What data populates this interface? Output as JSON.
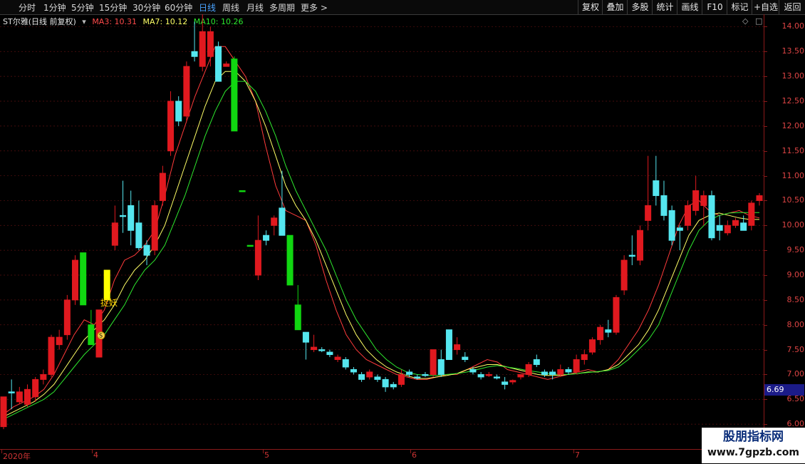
{
  "toolbar": {
    "periods": [
      "分时",
      "1分钟",
      "5分钟",
      "15分钟",
      "30分钟",
      "60分钟",
      "日线",
      "周线",
      "月线",
      "多周期",
      "更多 >"
    ],
    "active_period": "日线",
    "right_buttons": [
      "复权",
      "叠加",
      "多股",
      "统计",
      "画线",
      "F10",
      "标记",
      "+自选",
      "返回"
    ]
  },
  "legend": {
    "title": "ST尔雅(日线 前复权)",
    "ma3": "MA3: 10.31",
    "ma7": "MA7: 10.12",
    "ma10": "MA10: 10.26"
  },
  "annotation": {
    "label": "捉妖",
    "badge": "S"
  },
  "current_price": "6.69",
  "x_labels": [
    "2020年",
    "4",
    "5",
    "6",
    "7"
  ],
  "watermark": {
    "line1": "股朋指标网",
    "line2": "www.7gpzb.com"
  },
  "colors": {
    "up": "#e0191f",
    "down": "#55e6ef",
    "green": "#11d611",
    "yellow": "#ffff00",
    "ma3": "#ff3b3b",
    "ma7": "#ffff66",
    "ma10": "#2ee82e",
    "axis": "#8b1a1a"
  },
  "chart_data": {
    "type": "candlestick",
    "title": "ST尔雅(日线 前复权)",
    "ylim": [
      5.5,
      14.25
    ],
    "y_ticks": [
      6.0,
      6.5,
      7.0,
      7.5,
      8.0,
      8.5,
      9.0,
      9.5,
      10.0,
      10.5,
      11.0,
      11.5,
      12.0,
      12.5,
      13.0,
      13.5,
      14.0
    ],
    "series": [
      {
        "name": "MA3",
        "values": [
          6.2,
          6.35,
          6.45,
          6.55,
          6.7,
          7.0,
          7.4,
          7.8,
          8.1,
          8.0,
          8.3,
          8.9,
          9.3,
          9.4,
          9.6,
          9.9,
          10.6,
          11.4,
          12.0,
          12.6,
          13.1,
          13.6,
          13.6,
          13.3,
          13.0,
          12.5,
          11.6,
          10.8,
          10.3,
          10.2,
          10.1,
          9.6,
          8.9,
          8.3,
          7.8,
          7.5,
          7.3,
          7.2,
          7.1,
          7.0,
          6.95,
          6.9,
          6.9,
          6.95,
          7.0,
          7.0,
          7.1,
          7.2,
          7.3,
          7.25,
          7.1,
          7.05,
          7.0,
          6.95,
          6.9,
          6.95,
          7.0,
          7.05,
          7.1,
          7.05,
          7.1,
          7.3,
          7.6,
          7.9,
          8.3,
          8.8,
          9.4,
          10.0,
          10.4,
          10.5,
          10.3,
          10.2,
          10.25,
          10.3,
          10.2,
          10.15
        ]
      },
      {
        "name": "MA7",
        "values": [
          6.15,
          6.25,
          6.35,
          6.45,
          6.6,
          6.8,
          7.1,
          7.4,
          7.7,
          7.9,
          8.1,
          8.4,
          8.8,
          9.1,
          9.3,
          9.6,
          10.0,
          10.6,
          11.2,
          11.8,
          12.4,
          12.9,
          13.1,
          13.1,
          12.9,
          12.5,
          12.0,
          11.4,
          10.8,
          10.4,
          10.1,
          9.7,
          9.2,
          8.7,
          8.2,
          7.8,
          7.5,
          7.3,
          7.15,
          7.05,
          6.98,
          6.92,
          6.92,
          6.95,
          6.98,
          7.02,
          7.1,
          7.15,
          7.2,
          7.2,
          7.15,
          7.1,
          7.05,
          7.0,
          6.98,
          6.98,
          7.0,
          7.02,
          7.05,
          7.05,
          7.1,
          7.2,
          7.4,
          7.6,
          7.9,
          8.3,
          8.8,
          9.3,
          9.8,
          10.1,
          10.2,
          10.25,
          10.2,
          10.15,
          10.12,
          10.12
        ]
      },
      {
        "name": "MA10",
        "values": [
          6.1,
          6.2,
          6.3,
          6.4,
          6.5,
          6.65,
          6.9,
          7.15,
          7.4,
          7.6,
          7.8,
          8.1,
          8.4,
          8.8,
          9.1,
          9.3,
          9.6,
          10.1,
          10.6,
          11.2,
          11.8,
          12.3,
          12.7,
          12.9,
          12.9,
          12.7,
          12.3,
          11.8,
          11.2,
          10.7,
          10.3,
          9.9,
          9.5,
          9.0,
          8.5,
          8.1,
          7.8,
          7.5,
          7.3,
          7.15,
          7.05,
          7.0,
          6.98,
          6.98,
          7.0,
          7.02,
          7.05,
          7.1,
          7.15,
          7.18,
          7.15,
          7.12,
          7.08,
          7.05,
          7.02,
          7.0,
          7.0,
          7.02,
          7.04,
          7.06,
          7.08,
          7.15,
          7.3,
          7.5,
          7.7,
          8.0,
          8.5,
          9.0,
          9.5,
          9.9,
          10.1,
          10.2,
          10.25,
          10.26,
          10.26,
          10.26
        ]
      }
    ],
    "candles": [
      {
        "o": 6.55,
        "h": 6.55,
        "l": 5.9,
        "c": 5.95,
        "dir": "up"
      },
      {
        "o": 6.65,
        "h": 6.9,
        "l": 6.3,
        "c": 6.65,
        "dir": "down"
      },
      {
        "o": 6.45,
        "h": 6.75,
        "l": 6.4,
        "c": 6.65,
        "dir": "up"
      },
      {
        "o": 6.4,
        "h": 6.8,
        "l": 6.35,
        "c": 6.7,
        "dir": "up"
      },
      {
        "o": 6.55,
        "h": 6.95,
        "l": 6.45,
        "c": 6.9,
        "dir": "up"
      },
      {
        "o": 6.9,
        "h": 7.1,
        "l": 6.8,
        "c": 7.0,
        "dir": "up"
      },
      {
        "o": 7.0,
        "h": 7.8,
        "l": 6.95,
        "c": 7.75,
        "dir": "up"
      },
      {
        "o": 7.6,
        "h": 7.9,
        "l": 7.5,
        "c": 7.75,
        "dir": "up"
      },
      {
        "o": 7.8,
        "h": 8.6,
        "l": 7.7,
        "c": 8.5,
        "dir": "up"
      },
      {
        "o": 8.5,
        "h": 9.4,
        "l": 8.4,
        "c": 9.3,
        "dir": "up"
      },
      {
        "o": 9.45,
        "h": 9.45,
        "l": 8.4,
        "c": 8.4,
        "dir": "green"
      },
      {
        "o": 8.0,
        "h": 8.3,
        "l": 7.6,
        "c": 7.6,
        "dir": "green"
      },
      {
        "o": 8.3,
        "h": 8.3,
        "l": 7.35,
        "c": 7.35,
        "dir": "up"
      },
      {
        "o": 9.1,
        "h": 9.1,
        "l": 8.5,
        "c": 8.5,
        "dir": "yellow"
      },
      {
        "o": 9.6,
        "h": 10.4,
        "l": 9.5,
        "c": 10.05,
        "dir": "up"
      },
      {
        "o": 10.2,
        "h": 10.9,
        "l": 9.85,
        "c": 10.2,
        "dir": "down"
      },
      {
        "o": 10.4,
        "h": 10.7,
        "l": 9.6,
        "c": 9.9,
        "dir": "down"
      },
      {
        "o": 10.05,
        "h": 10.5,
        "l": 9.5,
        "c": 9.55,
        "dir": "down"
      },
      {
        "o": 9.4,
        "h": 9.7,
        "l": 9.2,
        "c": 9.6,
        "dir": "down"
      },
      {
        "o": 9.5,
        "h": 10.5,
        "l": 9.4,
        "c": 10.4,
        "dir": "up"
      },
      {
        "o": 10.5,
        "h": 11.2,
        "l": 10.4,
        "c": 11.05,
        "dir": "up"
      },
      {
        "o": 11.5,
        "h": 12.7,
        "l": 11.4,
        "c": 12.5,
        "dir": "up"
      },
      {
        "o": 12.5,
        "h": 12.6,
        "l": 12.0,
        "c": 12.1,
        "dir": "down"
      },
      {
        "o": 12.2,
        "h": 13.3,
        "l": 12.1,
        "c": 13.2,
        "dir": "up"
      },
      {
        "o": 13.4,
        "h": 14.1,
        "l": 13.3,
        "c": 13.5,
        "dir": "down"
      },
      {
        "o": 13.2,
        "h": 14.4,
        "l": 13.1,
        "c": 13.9,
        "dir": "up"
      },
      {
        "o": 13.4,
        "h": 14.0,
        "l": 13.2,
        "c": 13.9,
        "dir": "up"
      },
      {
        "o": 13.6,
        "h": 13.7,
        "l": 12.9,
        "c": 12.9,
        "dir": "down"
      },
      {
        "o": 13.2,
        "h": 13.3,
        "l": 13.2,
        "c": 13.25,
        "dir": "up"
      },
      {
        "o": 13.35,
        "h": 13.4,
        "l": 11.9,
        "c": 11.9,
        "dir": "green"
      },
      {
        "o": 10.7,
        "h": 10.7,
        "l": 10.7,
        "c": 10.7,
        "dir": "green"
      },
      {
        "o": 9.6,
        "h": 9.6,
        "l": 9.6,
        "c": 9.6,
        "dir": "green"
      },
      {
        "o": 9.7,
        "h": 10.2,
        "l": 8.9,
        "c": 9.0,
        "dir": "up"
      },
      {
        "o": 9.7,
        "h": 9.9,
        "l": 9.6,
        "c": 9.8,
        "dir": "down"
      },
      {
        "o": 10.0,
        "h": 10.2,
        "l": 9.8,
        "c": 10.15,
        "dir": "up"
      },
      {
        "o": 10.35,
        "h": 11.1,
        "l": 9.8,
        "c": 9.8,
        "dir": "down"
      },
      {
        "o": 9.8,
        "h": 9.8,
        "l": 8.8,
        "c": 8.8,
        "dir": "green"
      },
      {
        "o": 8.4,
        "h": 8.8,
        "l": 7.9,
        "c": 7.9,
        "dir": "green"
      },
      {
        "o": 7.85,
        "h": 7.85,
        "l": 7.3,
        "c": 7.65,
        "dir": "down"
      },
      {
        "o": 7.55,
        "h": 7.8,
        "l": 7.45,
        "c": 7.5,
        "dir": "up"
      },
      {
        "o": 7.5,
        "h": 7.55,
        "l": 7.45,
        "c": 7.5,
        "dir": "down"
      },
      {
        "o": 7.45,
        "h": 7.5,
        "l": 7.35,
        "c": 7.4,
        "dir": "down"
      },
      {
        "o": 7.35,
        "h": 7.4,
        "l": 7.25,
        "c": 7.3,
        "dir": "up"
      },
      {
        "o": 7.3,
        "h": 7.35,
        "l": 7.1,
        "c": 7.15,
        "dir": "down"
      },
      {
        "o": 7.1,
        "h": 7.15,
        "l": 7.0,
        "c": 7.05,
        "dir": "down"
      },
      {
        "o": 7.0,
        "h": 7.05,
        "l": 6.85,
        "c": 6.9,
        "dir": "down"
      },
      {
        "o": 6.95,
        "h": 7.1,
        "l": 6.9,
        "c": 7.05,
        "dir": "up"
      },
      {
        "o": 6.95,
        "h": 7.0,
        "l": 6.85,
        "c": 6.9,
        "dir": "down"
      },
      {
        "o": 6.9,
        "h": 6.95,
        "l": 6.65,
        "c": 6.75,
        "dir": "down"
      },
      {
        "o": 6.75,
        "h": 6.85,
        "l": 6.7,
        "c": 6.8,
        "dir": "down"
      },
      {
        "o": 6.8,
        "h": 7.1,
        "l": 6.75,
        "c": 7.0,
        "dir": "up"
      },
      {
        "o": 7.05,
        "h": 7.1,
        "l": 6.95,
        "c": 7.0,
        "dir": "down"
      },
      {
        "o": 6.95,
        "h": 7.0,
        "l": 6.9,
        "c": 6.95,
        "dir": "down"
      },
      {
        "o": 7.0,
        "h": 7.05,
        "l": 6.95,
        "c": 7.0,
        "dir": "down"
      },
      {
        "o": 7.0,
        "h": 7.5,
        "l": 6.95,
        "c": 7.5,
        "dir": "up"
      },
      {
        "o": 7.3,
        "h": 7.5,
        "l": 6.95,
        "c": 7.0,
        "dir": "down"
      },
      {
        "o": 7.9,
        "h": 7.9,
        "l": 7.3,
        "c": 7.3,
        "dir": "down"
      },
      {
        "o": 7.6,
        "h": 7.75,
        "l": 7.4,
        "c": 7.5,
        "dir": "up"
      },
      {
        "o": 7.35,
        "h": 7.45,
        "l": 7.25,
        "c": 7.3,
        "dir": "down"
      },
      {
        "o": 7.1,
        "h": 7.15,
        "l": 7.0,
        "c": 7.05,
        "dir": "down"
      },
      {
        "o": 7.0,
        "h": 7.05,
        "l": 6.9,
        "c": 6.95,
        "dir": "down"
      },
      {
        "o": 7.0,
        "h": 7.05,
        "l": 6.95,
        "c": 7.0,
        "dir": "up"
      },
      {
        "o": 6.95,
        "h": 7.0,
        "l": 6.9,
        "c": 6.95,
        "dir": "down"
      },
      {
        "o": 6.85,
        "h": 6.95,
        "l": 6.7,
        "c": 6.8,
        "dir": "down"
      },
      {
        "o": 6.85,
        "h": 6.9,
        "l": 6.8,
        "c": 6.88,
        "dir": "up"
      },
      {
        "o": 6.95,
        "h": 7.0,
        "l": 6.9,
        "c": 7.0,
        "dir": "up"
      },
      {
        "o": 7.0,
        "h": 7.25,
        "l": 6.95,
        "c": 7.2,
        "dir": "up"
      },
      {
        "o": 7.3,
        "h": 7.4,
        "l": 7.15,
        "c": 7.2,
        "dir": "down"
      },
      {
        "o": 7.0,
        "h": 7.1,
        "l": 6.95,
        "c": 7.05,
        "dir": "down"
      },
      {
        "o": 7.0,
        "h": 7.1,
        "l": 6.9,
        "c": 7.05,
        "dir": "down"
      },
      {
        "o": 7.0,
        "h": 7.2,
        "l": 6.95,
        "c": 7.1,
        "dir": "up"
      },
      {
        "o": 7.1,
        "h": 7.15,
        "l": 7.0,
        "c": 7.05,
        "dir": "down"
      },
      {
        "o": 7.05,
        "h": 7.4,
        "l": 7.0,
        "c": 7.3,
        "dir": "up"
      },
      {
        "o": 7.3,
        "h": 7.5,
        "l": 7.2,
        "c": 7.4,
        "dir": "up"
      },
      {
        "o": 7.45,
        "h": 7.75,
        "l": 7.4,
        "c": 7.7,
        "dir": "up"
      },
      {
        "o": 7.7,
        "h": 8.0,
        "l": 7.6,
        "c": 7.95,
        "dir": "up"
      },
      {
        "o": 7.9,
        "h": 8.1,
        "l": 7.75,
        "c": 7.85,
        "dir": "down"
      },
      {
        "o": 7.85,
        "h": 8.6,
        "l": 7.8,
        "c": 8.55,
        "dir": "up"
      },
      {
        "o": 8.7,
        "h": 9.4,
        "l": 8.6,
        "c": 9.3,
        "dir": "up"
      },
      {
        "o": 9.4,
        "h": 9.8,
        "l": 9.2,
        "c": 9.4,
        "dir": "down"
      },
      {
        "o": 9.3,
        "h": 10.0,
        "l": 9.2,
        "c": 9.9,
        "dir": "up"
      },
      {
        "o": 10.1,
        "h": 11.4,
        "l": 9.9,
        "c": 10.4,
        "dir": "up"
      },
      {
        "o": 10.9,
        "h": 11.4,
        "l": 10.4,
        "c": 10.6,
        "dir": "down"
      },
      {
        "o": 10.6,
        "h": 10.9,
        "l": 10.1,
        "c": 10.2,
        "dir": "down"
      },
      {
        "o": 10.3,
        "h": 10.4,
        "l": 9.6,
        "c": 9.7,
        "dir": "down"
      },
      {
        "o": 9.9,
        "h": 10.0,
        "l": 9.5,
        "c": 9.95,
        "dir": "down"
      },
      {
        "o": 10.0,
        "h": 10.5,
        "l": 9.9,
        "c": 10.4,
        "dir": "up"
      },
      {
        "o": 10.3,
        "h": 11.0,
        "l": 10.2,
        "c": 10.7,
        "dir": "up"
      },
      {
        "o": 10.4,
        "h": 10.7,
        "l": 10.0,
        "c": 10.6,
        "dir": "up"
      },
      {
        "o": 10.6,
        "h": 10.7,
        "l": 9.7,
        "c": 9.75,
        "dir": "down"
      },
      {
        "o": 10.0,
        "h": 10.2,
        "l": 9.7,
        "c": 9.9,
        "dir": "down"
      },
      {
        "o": 9.85,
        "h": 10.1,
        "l": 9.8,
        "c": 10.0,
        "dir": "up"
      },
      {
        "o": 10.0,
        "h": 10.15,
        "l": 9.95,
        "c": 10.1,
        "dir": "up"
      },
      {
        "o": 10.05,
        "h": 10.2,
        "l": 9.9,
        "c": 9.9,
        "dir": "down"
      },
      {
        "o": 10.0,
        "h": 10.5,
        "l": 9.9,
        "c": 10.45,
        "dir": "up"
      },
      {
        "o": 10.5,
        "h": 10.65,
        "l": 10.4,
        "c": 10.6,
        "dir": "up"
      }
    ]
  }
}
